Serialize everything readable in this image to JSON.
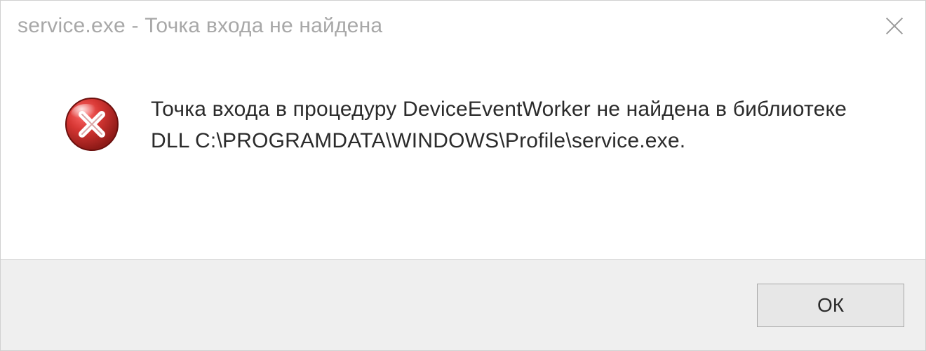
{
  "titlebar": {
    "title": "service.exe - Точка входа не найдена"
  },
  "content": {
    "message": "Точка входа в процедуру DeviceEventWorker не найдена в библиотеке DLL C:\\PROGRAMDATA\\WINDOWS\\Profile\\service.exe."
  },
  "buttons": {
    "ok_label": "ОК"
  },
  "icons": {
    "close": "close-icon",
    "error": "error-icon"
  },
  "colors": {
    "title_text": "#a8a8a8",
    "body_text": "#2b2b2b",
    "button_bg": "#e7e7e7",
    "footer_bg": "#efefef",
    "error_red": "#c1272d"
  }
}
